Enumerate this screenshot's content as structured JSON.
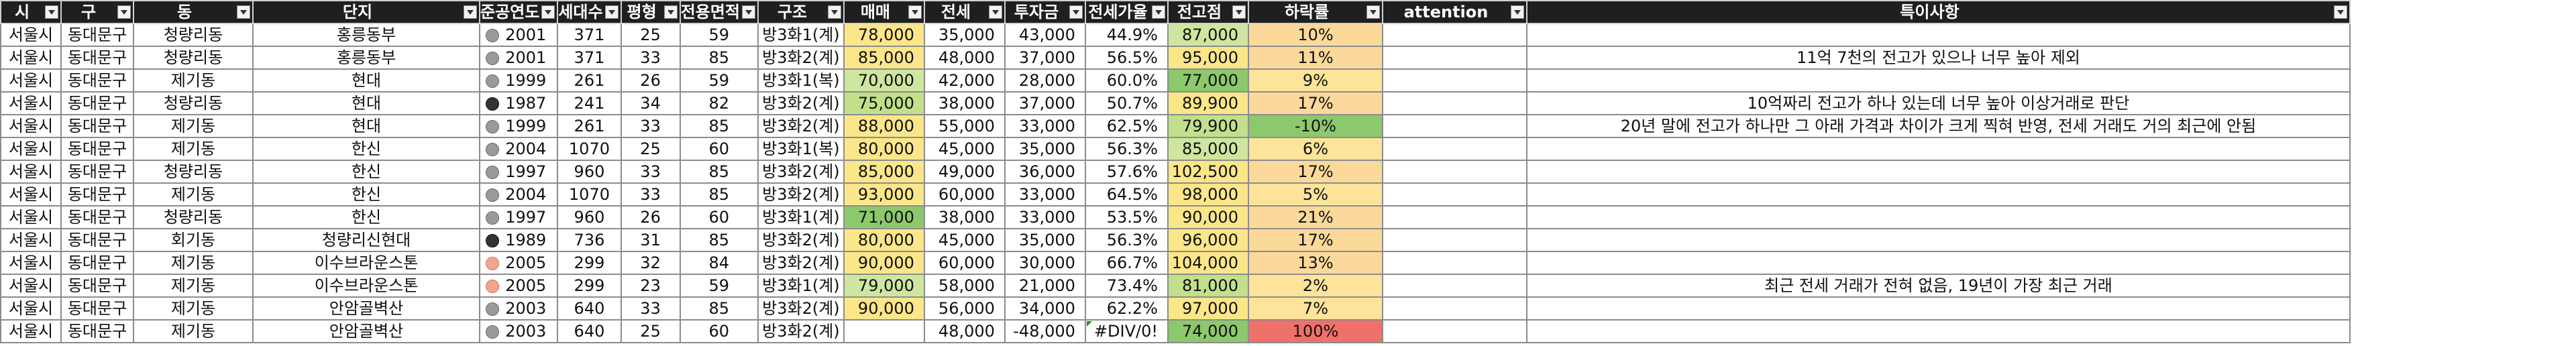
{
  "headers": [
    "시",
    "구",
    "동",
    "단지",
    "준공연도",
    "세대수",
    "평형",
    "전용면적",
    "구조",
    "매매",
    "전세",
    "투자금",
    "전세가율",
    "전고점",
    "하락률",
    "attention",
    "특이사항"
  ],
  "rows": [
    {
      "si": "서울시",
      "gu": "동대문구",
      "dong": "청량리동",
      "danji": "홍릉동부",
      "dot": "grey",
      "year": "2001",
      "units": "371",
      "pyeong": "25",
      "area": "59",
      "gujo": "방3화1(계)",
      "sale": "78,000",
      "jeonse": "35,000",
      "invest": "43,000",
      "rate": "44.9%",
      "peak": "87,000",
      "drop": "10%",
      "attention": "",
      "note": "",
      "sale_bg": "yellow",
      "peak_bg": "lightgreen",
      "drop_bg": "peach"
    },
    {
      "si": "서울시",
      "gu": "동대문구",
      "dong": "청량리동",
      "danji": "홍릉동부",
      "dot": "grey",
      "year": "2001",
      "units": "371",
      "pyeong": "33",
      "area": "85",
      "gujo": "방3화2(계)",
      "sale": "85,000",
      "jeonse": "48,000",
      "invest": "37,000",
      "rate": "56.5%",
      "peak": "95,000",
      "drop": "11%",
      "attention": "",
      "note": "11억 7천의 전고가 있으나 너무 높아 제외",
      "sale_bg": "yellow",
      "peak_bg": "yellow",
      "drop_bg": "peach"
    },
    {
      "si": "서울시",
      "gu": "동대문구",
      "dong": "제기동",
      "danji": "현대",
      "dot": "grey",
      "year": "1999",
      "units": "261",
      "pyeong": "26",
      "area": "59",
      "gujo": "방3화1(복)",
      "sale": "70,000",
      "jeonse": "42,000",
      "invest": "28,000",
      "rate": "60.0%",
      "peak": "77,000",
      "drop": "9%",
      "attention": "",
      "note": "",
      "sale_bg": "lightgreen",
      "peak_bg": "green",
      "drop_bg": "orange"
    },
    {
      "si": "서울시",
      "gu": "동대문구",
      "dong": "청량리동",
      "danji": "현대",
      "dot": "dark",
      "year": "1987",
      "units": "241",
      "pyeong": "34",
      "area": "82",
      "gujo": "방3화2(계)",
      "sale": "75,000",
      "jeonse": "38,000",
      "invest": "37,000",
      "rate": "50.7%",
      "peak": "89,900",
      "drop": "17%",
      "attention": "",
      "note": "10억짜리 전고가 하나 있는데 너무 높아 이상거래로 판단",
      "sale_bg": "ygreen",
      "peak_bg": "yellow",
      "drop_bg": "peach"
    },
    {
      "si": "서울시",
      "gu": "동대문구",
      "dong": "제기동",
      "danji": "현대",
      "dot": "grey",
      "year": "1999",
      "units": "261",
      "pyeong": "33",
      "area": "85",
      "gujo": "방3화2(계)",
      "sale": "88,000",
      "jeonse": "55,000",
      "invest": "33,000",
      "rate": "62.5%",
      "peak": "79,900",
      "drop": "-10%",
      "attention": "",
      "note": "20년 말에 전고가 하나만 그 아래 가격과 차이가 크게 찍혀 반영, 전세 거래도 거의 최근에 안됨",
      "sale_bg": "yellow",
      "peak_bg": "ygreen",
      "drop_bg": "green"
    },
    {
      "si": "서울시",
      "gu": "동대문구",
      "dong": "제기동",
      "danji": "한신",
      "dot": "grey",
      "year": "2004",
      "units": "1070",
      "pyeong": "25",
      "area": "60",
      "gujo": "방3화1(복)",
      "sale": "80,000",
      "jeonse": "45,000",
      "invest": "35,000",
      "rate": "56.3%",
      "peak": "85,000",
      "drop": "6%",
      "attention": "",
      "note": "",
      "sale_bg": "yellow",
      "peak_bg": "lightgreen",
      "drop_bg": "orange"
    },
    {
      "si": "서울시",
      "gu": "동대문구",
      "dong": "청량리동",
      "danji": "한신",
      "dot": "grey",
      "year": "1997",
      "units": "960",
      "pyeong": "33",
      "area": "85",
      "gujo": "방3화2(계)",
      "sale": "85,000",
      "jeonse": "49,000",
      "invest": "36,000",
      "rate": "57.6%",
      "peak": "102,500",
      "drop": "17%",
      "attention": "",
      "note": "",
      "sale_bg": "yellow",
      "peak_bg": "yellow",
      "drop_bg": "peach"
    },
    {
      "si": "서울시",
      "gu": "동대문구",
      "dong": "제기동",
      "danji": "한신",
      "dot": "grey",
      "year": "2004",
      "units": "1070",
      "pyeong": "33",
      "area": "85",
      "gujo": "방3화2(계)",
      "sale": "93,000",
      "jeonse": "60,000",
      "invest": "33,000",
      "rate": "64.5%",
      "peak": "98,000",
      "drop": "5%",
      "attention": "",
      "note": "",
      "sale_bg": "yellow",
      "peak_bg": "yellow",
      "drop_bg": "orange"
    },
    {
      "si": "서울시",
      "gu": "동대문구",
      "dong": "청량리동",
      "danji": "한신",
      "dot": "grey",
      "year": "1997",
      "units": "960",
      "pyeong": "26",
      "area": "60",
      "gujo": "방3화1(계)",
      "sale": "71,000",
      "jeonse": "38,000",
      "invest": "33,000",
      "rate": "53.5%",
      "peak": "90,000",
      "drop": "21%",
      "attention": "",
      "note": "",
      "sale_bg": "green",
      "peak_bg": "yellow",
      "drop_bg": "peach"
    },
    {
      "si": "서울시",
      "gu": "동대문구",
      "dong": "회기동",
      "danji": "청량리신현대",
      "dot": "dark",
      "year": "1989",
      "units": "736",
      "pyeong": "31",
      "area": "85",
      "gujo": "방3화2(계)",
      "sale": "80,000",
      "jeonse": "45,000",
      "invest": "35,000",
      "rate": "56.3%",
      "peak": "96,000",
      "drop": "17%",
      "attention": "",
      "note": "",
      "sale_bg": "yellow",
      "peak_bg": "yellow",
      "drop_bg": "peach"
    },
    {
      "si": "서울시",
      "gu": "동대문구",
      "dong": "제기동",
      "danji": "이수브라운스톤",
      "dot": "pink",
      "year": "2005",
      "units": "299",
      "pyeong": "32",
      "area": "84",
      "gujo": "방3화2(계)",
      "sale": "90,000",
      "jeonse": "60,000",
      "invest": "30,000",
      "rate": "66.7%",
      "peak": "104,000",
      "drop": "13%",
      "attention": "",
      "note": "",
      "sale_bg": "yellow",
      "peak_bg": "yellow",
      "drop_bg": "peach"
    },
    {
      "si": "서울시",
      "gu": "동대문구",
      "dong": "제기동",
      "danji": "이수브라운스톤",
      "dot": "pink",
      "year": "2005",
      "units": "299",
      "pyeong": "23",
      "area": "59",
      "gujo": "방3화1(계)",
      "sale": "79,000",
      "jeonse": "58,000",
      "invest": "21,000",
      "rate": "73.4%",
      "peak": "81,000",
      "drop": "2%",
      "attention": "",
      "note": "최근 전세 거래가 전혀 없음, 19년이 가장 최근 거래",
      "sale_bg": "lightgreen",
      "peak_bg": "ygreen",
      "drop_bg": "orange"
    },
    {
      "si": "서울시",
      "gu": "동대문구",
      "dong": "제기동",
      "danji": "안암골벽산",
      "dot": "grey",
      "year": "2003",
      "units": "640",
      "pyeong": "33",
      "area": "85",
      "gujo": "방3화2(계)",
      "sale": "90,000",
      "jeonse": "56,000",
      "invest": "34,000",
      "rate": "62.2%",
      "peak": "97,000",
      "drop": "7%",
      "attention": "",
      "note": "",
      "sale_bg": "yellow",
      "peak_bg": "yellow",
      "drop_bg": "orange"
    },
    {
      "si": "서울시",
      "gu": "동대문구",
      "dong": "제기동",
      "danji": "안암골벽산",
      "dot": "grey",
      "year": "2003",
      "units": "640",
      "pyeong": "25",
      "area": "60",
      "gujo": "방3화2(계)",
      "sale": "",
      "jeonse": "48,000",
      "invest": "-48,000",
      "rate": "#DIV/0!",
      "peak": "74,000",
      "drop": "100%",
      "attention": "",
      "note": "",
      "sale_bg": "none",
      "peak_bg": "green",
      "drop_bg": "red"
    }
  ]
}
